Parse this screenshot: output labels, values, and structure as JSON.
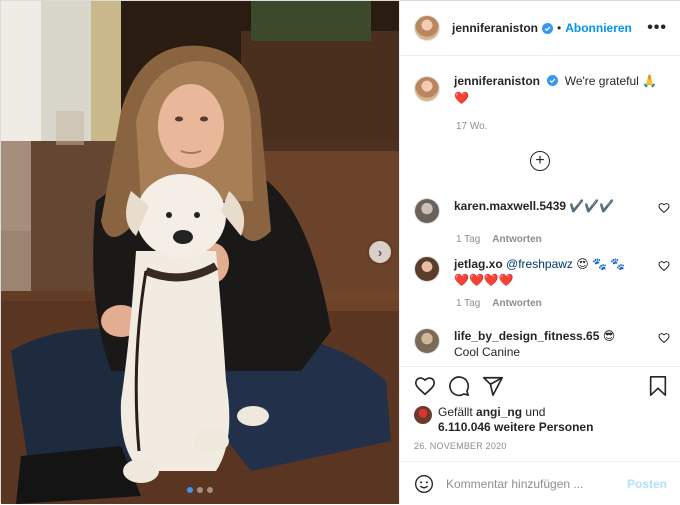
{
  "post": {
    "username": "jenniferaniston",
    "follow_label": "Abonnieren",
    "separator": "•",
    "more_label": "•••",
    "caption_text": "We're grateful 🙏 ❤️",
    "caption_time": "17 Wo.",
    "load_more_label": "+"
  },
  "photo": {
    "next_arrow": "›",
    "carousel_count": 3,
    "carousel_active": 1
  },
  "comments": [
    {
      "username": "karen.maxwell.5439",
      "text": "✔️✔️✔️",
      "time": "1 Tag",
      "reply_label": "Antworten",
      "has_meta": true
    },
    {
      "username": "jetlag.xo",
      "mention": "@freshpawz",
      "text": "😍 🐾 🐾 ❤️❤️❤️❤️",
      "time": "1 Tag",
      "reply_label": "Antworten",
      "has_meta": true
    },
    {
      "username": "life_by_design_fitness.65",
      "text": "😎 Cool Canine",
      "has_meta": false
    }
  ],
  "likes": {
    "prefix": "Gefällt",
    "liker": "angi_ng",
    "connector": "und",
    "count_text": "6.110.046 weitere Personen"
  },
  "date": "26. NOVEMBER 2020",
  "comment_box": {
    "placeholder": "Kommentar hinzufügen ...",
    "post_label": "Posten"
  },
  "colors": {
    "accent": "#0095f6",
    "verified": "#3897f0",
    "muted": "#8e8e8e",
    "post_disabled": "#b2dffc"
  },
  "icons": [
    "verified-icon",
    "more-icon",
    "add-comment-icon",
    "heart-icon",
    "comment-icon",
    "share-icon",
    "bookmark-icon",
    "smiley-icon",
    "next-arrow-icon"
  ]
}
